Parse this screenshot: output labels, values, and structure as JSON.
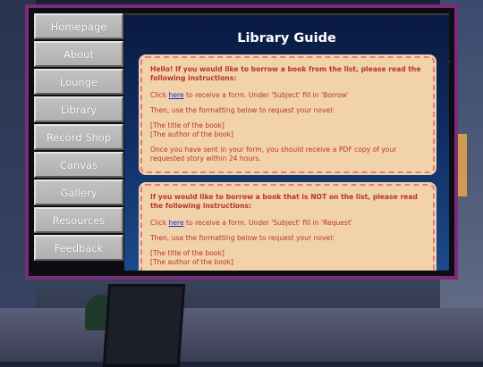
{
  "nav": {
    "items": [
      {
        "label": "Homepage"
      },
      {
        "label": "About"
      },
      {
        "label": "Lounge"
      },
      {
        "label": "Library"
      },
      {
        "label": "Record Shop"
      },
      {
        "label": "Canvas"
      },
      {
        "label": "Gallery"
      },
      {
        "label": "Resources"
      },
      {
        "label": "Feedback"
      }
    ]
  },
  "main": {
    "title": "Library Guide",
    "boxes": [
      {
        "heading": "Hello! If you would like to borrow a book from the list, please read the following instructions:",
        "click_prefix": "Click ",
        "link_text": "here",
        "click_suffix": " to receive a form. Under 'Subject' fill in 'Borrow'",
        "format_text": "Then, use the formatting below to request your novel:",
        "format_line1": "[The title of the book]",
        "format_line2": "[The author of the book]",
        "closing": "Once you have sent in your form, you should receive a PDF copy of your requested story within 24 hours."
      },
      {
        "heading": "If you would like to borrow a book that is NOT on the list, please read the following instructions:",
        "click_prefix": "Click ",
        "link_text": "here",
        "click_suffix": " to receive a form. Under 'Subject' fill in 'Request'",
        "format_text": "Then, use the formatting below to request your novel:",
        "format_line1": "[The title of the book]",
        "format_line2": "[The author of the book]"
      }
    ]
  },
  "colors": {
    "frame": "#7b2b7a",
    "box_bg": "#f2d2a9",
    "box_text": "#b5362a",
    "link": "#1a2ad0"
  }
}
